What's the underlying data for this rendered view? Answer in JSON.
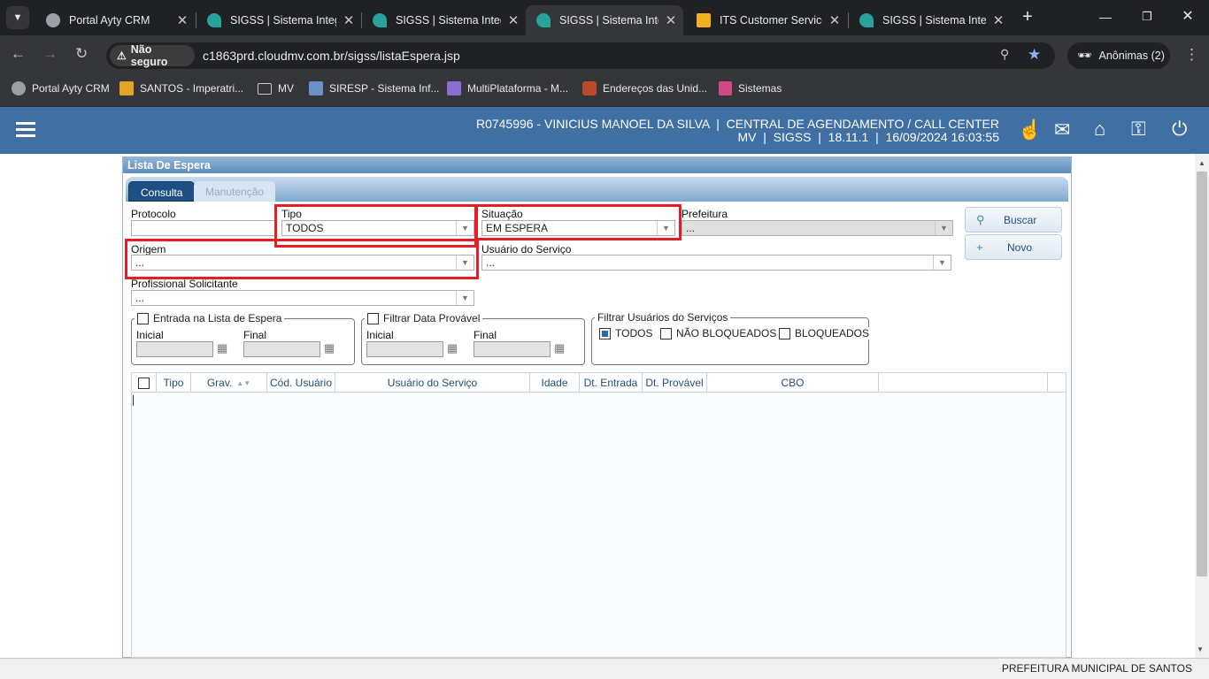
{
  "browser": {
    "tabs": [
      {
        "title": "Portal Ayty CRM",
        "icon": "globe-icon"
      },
      {
        "title": "SIGSS | Sistema Integ",
        "icon": "sigss-icon"
      },
      {
        "title": "SIGSS | Sistema Integ",
        "icon": "sigss-icon"
      },
      {
        "title": "SIGSS | Sistema Integ",
        "icon": "sigss-icon",
        "active": true
      },
      {
        "title": "ITS Customer Service",
        "icon": "its-icon"
      },
      {
        "title": "SIGSS | Sistema Integ",
        "icon": "sigss-icon"
      }
    ],
    "security_label": "Não seguro",
    "url": "c1863prd.cloudmv.com.br/sigss/listaEspera.jsp",
    "profile_label": "Anônimas (2)",
    "bookmarks": [
      {
        "label": "Portal Ayty CRM",
        "icon": "globe-icon"
      },
      {
        "label": "SANTOS - Imperatri...",
        "icon": "santos-icon"
      },
      {
        "label": "MV",
        "icon": "folder-icon"
      },
      {
        "label": "SIRESP - Sistema Inf...",
        "icon": "siresp-icon"
      },
      {
        "label": "MultiPlataforma - M...",
        "icon": "multi-icon"
      },
      {
        "label": "Endereços das Unid...",
        "icon": "crest-icon"
      },
      {
        "label": "Sistemas",
        "icon": "its-icon"
      }
    ]
  },
  "header": {
    "user_line": "R0745996 - VINICIUS MANOEL DA SILVA  |  CENTRAL DE AGENDAMENTO / CALL CENTER",
    "system_line": "MV  |  SIGSS  |  18.11.1  |  16/09/2024 16:03:55"
  },
  "panel": {
    "title": "Lista De Espera",
    "tabs": {
      "consulta": "Consulta",
      "manutencao": "Manutenção"
    }
  },
  "form": {
    "protocolo_label": "Protocolo",
    "protocolo_value": "",
    "tipo_label": "Tipo",
    "tipo_value": "TODOS",
    "situacao_label": "Situação",
    "situacao_value": "EM ESPERA",
    "prefeitura_label": "Prefeitura",
    "prefeitura_value": "...",
    "origem_label": "Origem",
    "origem_value": "...",
    "usuario_servico_label": "Usuário do Serviço",
    "usuario_servico_value": "...",
    "profissional_label": "Profissional Solicitante",
    "profissional_value": "...",
    "buscar_label": "Buscar",
    "novo_label": "Novo",
    "entrada_group": "Entrada na Lista de Espera",
    "data_provavel_group": "Filtrar Data Provável",
    "inicial_label": "Inicial",
    "final_label": "Final",
    "filtrar_usuarios_group": "Filtrar Usuários do Serviços",
    "todos_label": "TODOS",
    "nao_bloqueados_label": "NÃO BLOQUEADOS",
    "bloqueados_label": "BLOQUEADOS"
  },
  "grid": {
    "columns": [
      "Tipo",
      "Grav.",
      "Cód. Usuário",
      "Usuário do Serviço",
      "Idade",
      "Dt. Entrada",
      "Dt. Provável",
      "CBO"
    ],
    "rows": []
  },
  "footer": {
    "text": "PREFEITURA MUNICIPAL DE SANTOS"
  },
  "colors": {
    "app_header": "#3f6fa3",
    "highlight": "#e31e24",
    "accent": "#1f4f80"
  }
}
